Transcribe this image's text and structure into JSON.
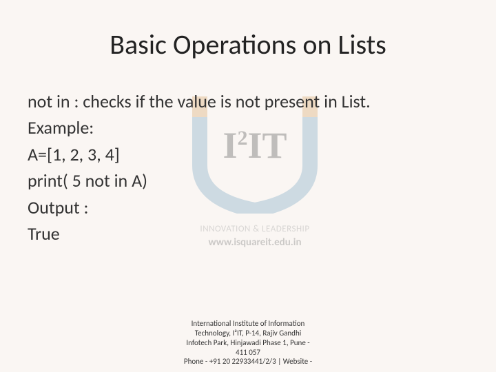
{
  "title": "Basic Operations on Lists",
  "body": {
    "line1": "not in : checks if the value is not present in List.",
    "line2": "Example:",
    "line3": "A=[1, 2, 3, 4]",
    "line4": "print( 5 not in A)",
    "line5": "Output :",
    "line6": "True"
  },
  "watermark": {
    "logo_text": "I²IT",
    "tagline1": "INNOVATION & LEADERSHIP",
    "tagline2": "www.isquareit.edu.in"
  },
  "footer": {
    "line1": "International Institute of Information",
    "line2": "Technology, I²IT, P-14, Rajiv Gandhi",
    "line3": "Infotech Park, Hinjawadi Phase 1, Pune -",
    "line4": "411 057",
    "line5": "Phone - +91 20 22933441/2/3 | Website -"
  }
}
